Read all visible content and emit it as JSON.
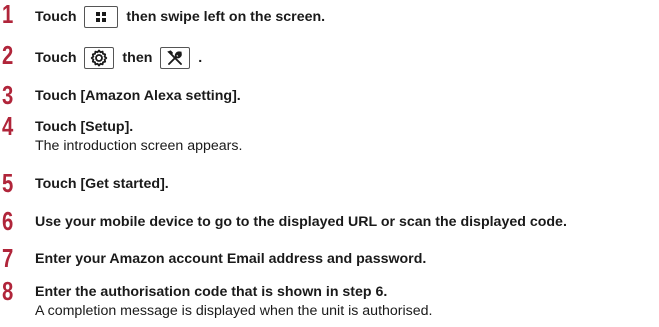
{
  "steps": [
    {
      "number": "1",
      "parts": [
        "Touch",
        "then swipe left on the screen."
      ],
      "icons": [
        "grid-icon"
      ]
    },
    {
      "number": "2",
      "parts": [
        "Touch",
        "then",
        "."
      ],
      "icons": [
        "gear-icon",
        "tools-icon"
      ]
    },
    {
      "number": "3",
      "text": "Touch [Amazon Alexa setting]."
    },
    {
      "number": "4",
      "text": "Touch [Setup].",
      "description": "The introduction screen appears."
    },
    {
      "number": "5",
      "text": "Touch [Get started]."
    },
    {
      "number": "6",
      "text": "Use your mobile device to go to the displayed URL or scan the displayed code."
    },
    {
      "number": "7",
      "text": "Enter your Amazon account Email address and password."
    },
    {
      "number": "8",
      "text": "Enter the authorisation code that is shown in step 6.",
      "description": "A completion message is displayed when the unit is authorised."
    }
  ],
  "colors": {
    "step_number": "#b0253a",
    "text": "#1a1a1a"
  }
}
